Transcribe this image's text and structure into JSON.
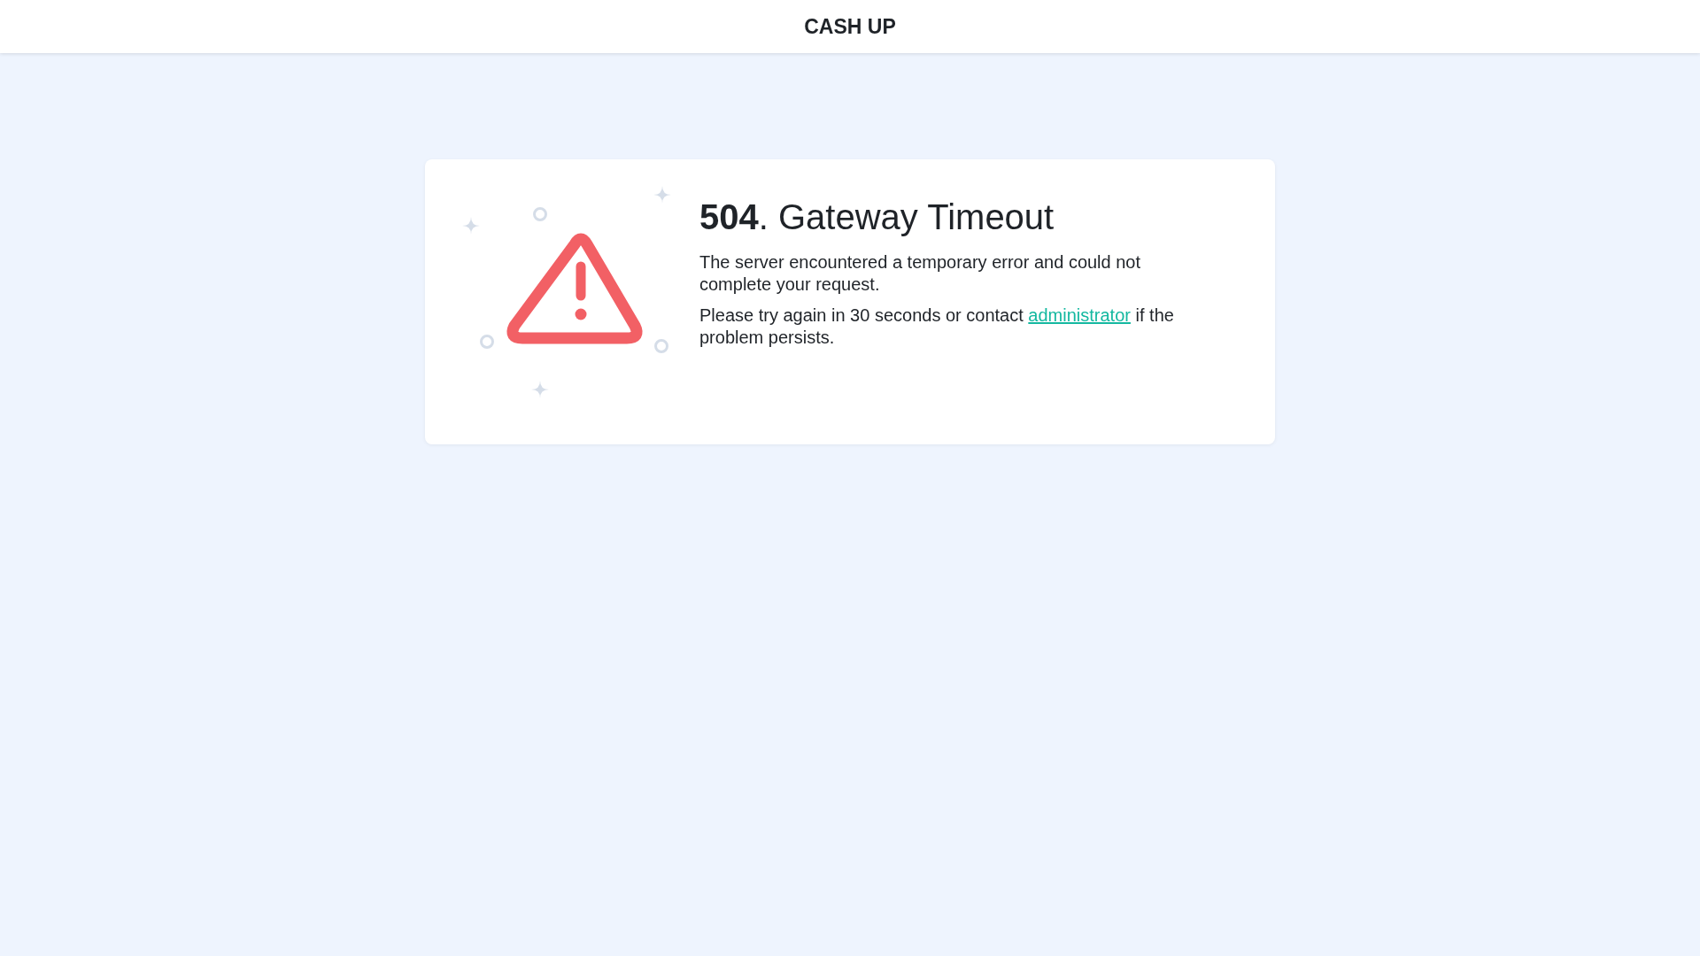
{
  "header": {
    "title": "CASH UP"
  },
  "error": {
    "title": "**504**. Gateway Timeout",
    "message": "The server encountered a temporary error and could not complete your request.",
    "hint": {
      "before": "Please try again in 30 seconds or contact",
      "link": "administrator",
      "after": "if the problem persists."
    }
  }
}
